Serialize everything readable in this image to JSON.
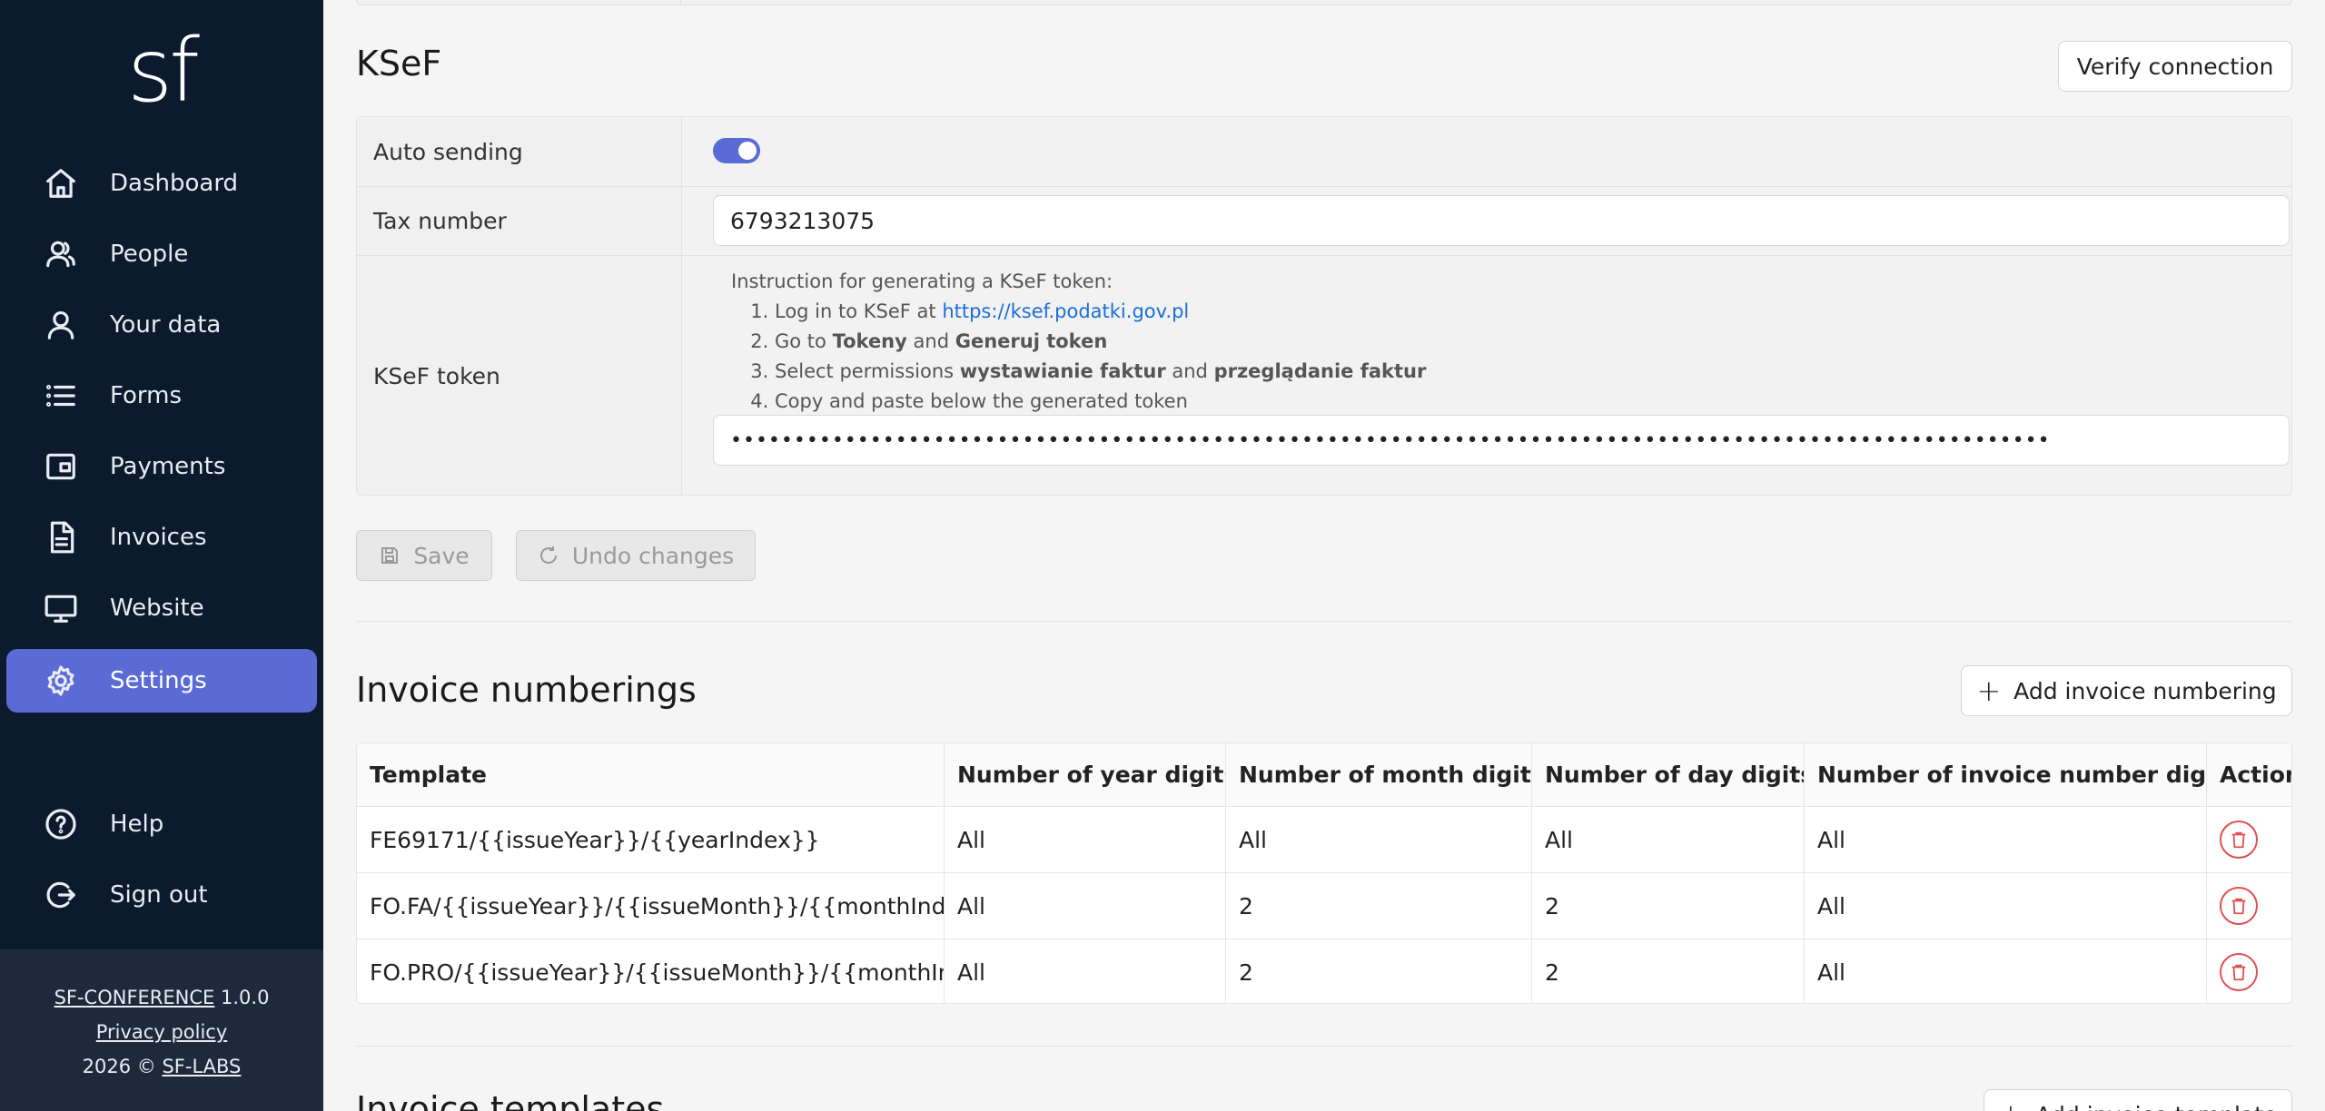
{
  "sidebar": {
    "logo": "sf",
    "items": [
      {
        "label": "Dashboard",
        "icon": "home-icon"
      },
      {
        "label": "People",
        "icon": "people-icon"
      },
      {
        "label": "Your data",
        "icon": "user-icon"
      },
      {
        "label": "Forms",
        "icon": "list-icon"
      },
      {
        "label": "Payments",
        "icon": "wallet-icon"
      },
      {
        "label": "Invoices",
        "icon": "document-icon"
      },
      {
        "label": "Website",
        "icon": "monitor-icon"
      },
      {
        "label": "Settings",
        "icon": "gear-icon",
        "active": true
      }
    ],
    "bottom_items": [
      {
        "label": "Help",
        "icon": "help-icon"
      },
      {
        "label": "Sign out",
        "icon": "sign-out-icon"
      }
    ],
    "footer": {
      "app_name": "SF-CONFERENCE",
      "version": "1.0.0",
      "privacy": "Privacy policy",
      "year": "2026 ©",
      "company": "SF-LABS"
    }
  },
  "ksef": {
    "title": "KSeF",
    "verify_label": "Verify connection",
    "auto_sending_label": "Auto sending",
    "auto_sending_on": true,
    "tax_number_label": "Tax number",
    "tax_number_value": "6793213075",
    "token_label": "KSeF token",
    "instruction_title": "Instruction for generating a KSeF token:",
    "step1_text": "Log in to KSeF at",
    "step1_link": "https://ksef.podatki.gov.pl",
    "step2_a": "Go to",
    "step2_b": "Tokeny",
    "step2_c": "and",
    "step2_d": "Generuj token",
    "step3_a": "Select permissions",
    "step3_b": "wystawianie faktur",
    "step3_c": "and",
    "step3_d": "przeglądanie faktur",
    "step4": "Copy and paste below the generated token",
    "token_value": "••••••••••••••••••••••••••••••••••••••••••••••••••••••••••••••••••••••••••••••••••••••••••••••••••••••••",
    "save_label": "Save",
    "undo_label": "Undo changes"
  },
  "numberings": {
    "title": "Invoice numberings",
    "add_label": "Add invoice numbering",
    "columns": [
      "Template",
      "Number of year digits",
      "Number of month digits",
      "Number of day digits",
      "Number of invoice number digits",
      "Actions"
    ],
    "rows": [
      [
        "FE69171/{{issueYear}}/{{yearIndex}}",
        "All",
        "All",
        "All",
        "All"
      ],
      [
        "FO.FA/{{issueYear}}/{{issueMonth}}/{{monthIndex}}",
        "All",
        "2",
        "2",
        "All"
      ],
      [
        "FO.PRO/{{issueYear}}/{{issueMonth}}/{{monthIndex}}",
        "All",
        "2",
        "2",
        "All"
      ]
    ]
  },
  "templates": {
    "title": "Invoice templates",
    "add_label": "Add invoice template"
  },
  "colors": {
    "sidebar_bg": "#0c1a2e",
    "accent": "#5a6bd6",
    "danger": "#e05050",
    "link": "#1a6ed8"
  }
}
